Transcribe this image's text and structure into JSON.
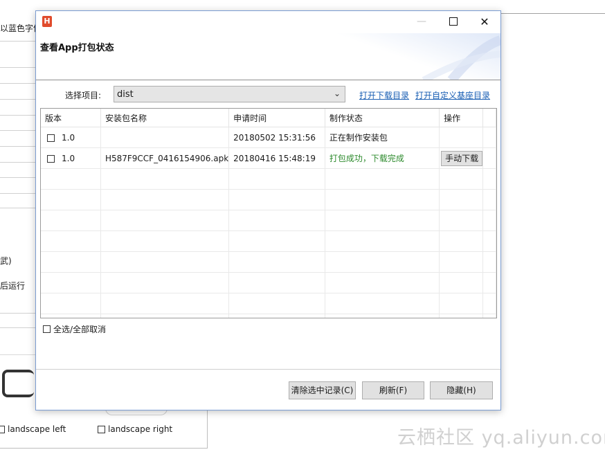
{
  "background": {
    "partial_texts": [
      "以蓝色字体",
      "武)",
      "后运行"
    ],
    "checkbox_left_label": "landscape left",
    "checkbox_right_label": "landscape right",
    "watermark": "云栖社区 yq.aliyun.com"
  },
  "dialog": {
    "app_icon": "H",
    "title": "查看App打包状态",
    "window_buttons": {
      "minimize": "—",
      "maximize": "",
      "close": "✕"
    },
    "project_label": "选择项目:",
    "project_value": "dist",
    "link_download_dir": "打开下载目录",
    "link_custom_dir": "打开自定义基座目录",
    "table": {
      "headers": [
        "版本",
        "安装包名称",
        "申请时间",
        "制作状态",
        "操作"
      ],
      "rows": [
        {
          "version": "1.0",
          "package": "",
          "time": "20180502 15:31:56",
          "status": "正在制作安装包",
          "action": ""
        },
        {
          "version": "1.0",
          "package": "H587F9CCF_0416154906.apk",
          "time": "20180416 15:48:19",
          "status": "打包成功，下载完成",
          "action": "手动下载"
        }
      ]
    },
    "select_all_label": "全选/全部取消",
    "buttons": {
      "clear": "清除选中记录(C)",
      "refresh": "刷新(F)",
      "hide": "隐藏(H)"
    },
    "colors": {
      "status_success": "#2e8b2e",
      "link": "#1a5fb4",
      "app_icon": "#e04b2c"
    }
  }
}
